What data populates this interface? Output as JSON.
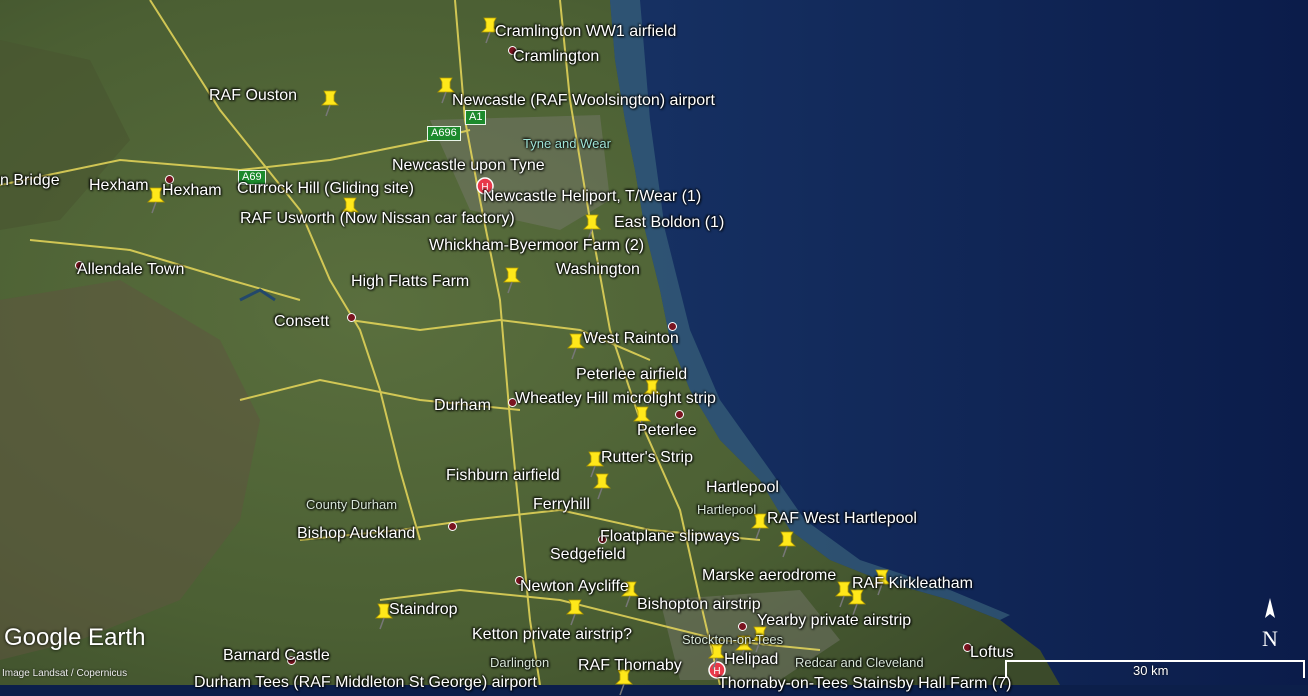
{
  "app": {
    "logo": "Google Earth",
    "credit": "Image Landsat / Copernicus"
  },
  "scale_bar": {
    "label": "30 km"
  },
  "compass": {
    "label": "N"
  },
  "places": [
    {
      "id": "cramlington-airfield",
      "text": "Cramlington WW1 airfield"
    },
    {
      "id": "cramlington",
      "text": "Cramlington"
    },
    {
      "id": "raf-ouston",
      "text": "RAF Ouston"
    },
    {
      "id": "newcastle-airport",
      "text": "Newcastle (RAF Woolsington) airport"
    },
    {
      "id": "tyne-and-wear",
      "text": "Tyne and Wear"
    },
    {
      "id": "newcastle",
      "text": "Newcastle upon Tyne"
    },
    {
      "id": "bridge",
      "text": "n Bridge"
    },
    {
      "id": "hexham-1",
      "text": "Hexham"
    },
    {
      "id": "hexham-2",
      "text": "Hexham"
    },
    {
      "id": "currock",
      "text": "Currock Hill (Gliding site)"
    },
    {
      "id": "heliport",
      "text": "Newcastle Heliport, T/Wear (1)"
    },
    {
      "id": "raf-usworth",
      "text": "RAF Usworth  (Now Nissan car factory)"
    },
    {
      "id": "east-boldon",
      "text": "East Boldon (1)"
    },
    {
      "id": "whickham",
      "text": "Whickham-Byermoor Farm (2)"
    },
    {
      "id": "allendale",
      "text": "Allendale Town"
    },
    {
      "id": "washington",
      "text": "Washington"
    },
    {
      "id": "high-flatts",
      "text": "High Flatts Farm"
    },
    {
      "id": "consett",
      "text": "Consett"
    },
    {
      "id": "west-rainton",
      "text": "West Rainton"
    },
    {
      "id": "peterlee-airfield",
      "text": "Peterlee airfield"
    },
    {
      "id": "durham",
      "text": "Durham"
    },
    {
      "id": "wheatley",
      "text": "Wheatley Hill microlight strip"
    },
    {
      "id": "peterlee",
      "text": "Peterlee"
    },
    {
      "id": "rutters",
      "text": "Rutter's Strip"
    },
    {
      "id": "fishburn",
      "text": "Fishburn airfield"
    },
    {
      "id": "hartlepool",
      "text": "Hartlepool"
    },
    {
      "id": "county-durham",
      "text": "County Durham"
    },
    {
      "id": "ferryhill",
      "text": "Ferryhill"
    },
    {
      "id": "hartlepool-2",
      "text": "Hartlepool"
    },
    {
      "id": "raf-west-hartlepool",
      "text": "RAF West Hartlepool"
    },
    {
      "id": "bishop-auckland",
      "text": "Bishop Auckland"
    },
    {
      "id": "floatplane",
      "text": "Floatplane slipways"
    },
    {
      "id": "sedgefield",
      "text": "Sedgefield"
    },
    {
      "id": "marske",
      "text": "Marske aerodrome"
    },
    {
      "id": "raf-kirkleatham",
      "text": "RAF Kirkleatham"
    },
    {
      "id": "newton-aycliffe",
      "text": "Newton Aycliffe"
    },
    {
      "id": "bishopton",
      "text": "Bishopton airstrip"
    },
    {
      "id": "staindrop",
      "text": "Staindrop"
    },
    {
      "id": "yearby",
      "text": "Yearby private airstrip"
    },
    {
      "id": "ketton",
      "text": "Ketton private airstrip?"
    },
    {
      "id": "stockton",
      "text": "Stockton-on-Tees"
    },
    {
      "id": "loftus",
      "text": "Loftus"
    },
    {
      "id": "barnard",
      "text": "Barnard Castle"
    },
    {
      "id": "helipad",
      "text": "Helipad"
    },
    {
      "id": "darlington",
      "text": "Darlington"
    },
    {
      "id": "raf-thornaby",
      "text": "RAF Thornaby"
    },
    {
      "id": "redcar",
      "text": "Redcar and Cleveland"
    },
    {
      "id": "durham-tees",
      "text": "Durham Tees (RAF Middleton St George) airport"
    },
    {
      "id": "thornaby",
      "text": "Thornaby-on-Tees Stainsby Hall Farm (7)"
    }
  ],
  "road_shields": [
    {
      "id": "a1",
      "text": "A1"
    },
    {
      "id": "a696",
      "text": "A696"
    },
    {
      "id": "a69",
      "text": "A69"
    }
  ]
}
